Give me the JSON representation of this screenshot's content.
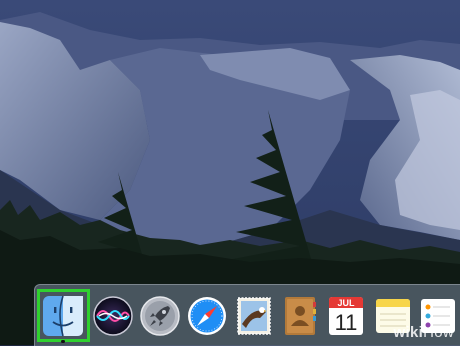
{
  "desktop": {
    "wallpaper": "mountain-valley-night-wallpaper",
    "colors": {
      "sky": "#2c3a63",
      "cliff": "#8a97b8",
      "trees": "#15231c",
      "highlight": "#2fd12f"
    }
  },
  "dock": {
    "items": [
      {
        "name": "finder",
        "icon": "finder-icon",
        "highlighted": true
      },
      {
        "name": "siri",
        "icon": "siri-icon"
      },
      {
        "name": "launchpad",
        "icon": "rocket-icon"
      },
      {
        "name": "safari",
        "icon": "compass-icon"
      },
      {
        "name": "mail",
        "icon": "eagle-stamp-icon"
      },
      {
        "name": "contacts",
        "icon": "address-book-icon"
      },
      {
        "name": "calendar",
        "icon": "calendar-icon",
        "month": "JUL",
        "day": "11"
      },
      {
        "name": "notes",
        "icon": "notes-icon"
      },
      {
        "name": "reminders",
        "icon": "reminders-icon"
      }
    ]
  },
  "watermark": {
    "wiki": "wiki",
    "how": "How"
  }
}
